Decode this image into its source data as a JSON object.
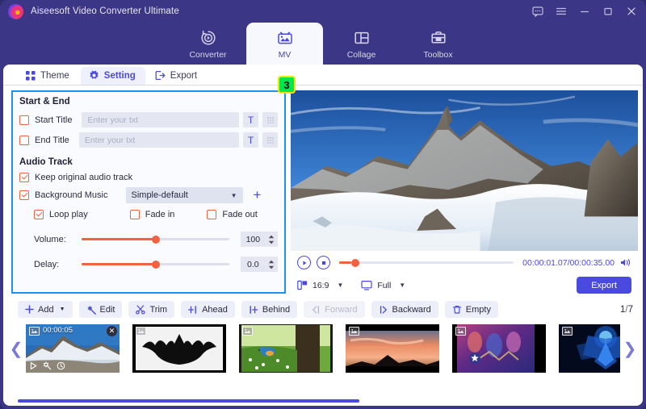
{
  "window": {
    "title": "Aiseesoft Video Converter Ultimate",
    "controls": [
      {
        "name": "feedback-icon",
        "label": "Feedback"
      },
      {
        "name": "menu-icon",
        "label": "Menu"
      },
      {
        "name": "minimize-icon",
        "label": "Minimize"
      },
      {
        "name": "maximize-icon",
        "label": "Maximize"
      },
      {
        "name": "close-icon",
        "label": "Close"
      }
    ]
  },
  "mainnav": {
    "items": [
      {
        "label": "Converter",
        "icon": "converter-icon",
        "active": false
      },
      {
        "label": "MV",
        "icon": "mv-icon",
        "active": true
      },
      {
        "label": "Collage",
        "icon": "collage-icon",
        "active": false
      },
      {
        "label": "Toolbox",
        "icon": "toolbox-icon",
        "active": false
      }
    ]
  },
  "lefttabs": {
    "items": [
      {
        "label": "Theme",
        "icon": "grid-icon",
        "active": false
      },
      {
        "label": "Setting",
        "icon": "gear-icon",
        "active": true
      },
      {
        "label": "Export",
        "icon": "export-icon",
        "active": false
      }
    ]
  },
  "callout": {
    "number": "3"
  },
  "settings": {
    "start_end": {
      "title": "Start & End",
      "start_title": {
        "label": "Start Title",
        "checked": false,
        "placeholder": "Enter your txt",
        "value": ""
      },
      "end_title": {
        "label": "End Title",
        "checked": false,
        "placeholder": "Enter your txt",
        "value": ""
      },
      "text_button": "T",
      "style_button": "style"
    },
    "audio_track": {
      "title": "Audio Track",
      "keep_original": {
        "label": "Keep original audio track",
        "checked": true
      },
      "background_music": {
        "label": "Background Music",
        "checked": true
      },
      "music_select": {
        "value": "Simple-default"
      },
      "add_button": "+",
      "loop_play": {
        "label": "Loop play",
        "checked": true
      },
      "fade_in": {
        "label": "Fade in",
        "checked": false
      },
      "fade_out": {
        "label": "Fade out",
        "checked": false
      },
      "volume": {
        "label": "Volume:",
        "value": "100",
        "percent": 50
      },
      "delay": {
        "label": "Delay:",
        "value": "0.0",
        "percent": 50
      }
    }
  },
  "player": {
    "play_label": "Play",
    "stop_label": "Stop",
    "timecode": "00:00:01.07/00:00:35.00",
    "volume_icon": "speaker-icon",
    "aspect_ratio": {
      "value": "16:9",
      "icon": "aspect-icon"
    },
    "zoom_mode": {
      "value": "Full",
      "icon": "screen-icon"
    },
    "export_label": "Export",
    "seek_percent": 7
  },
  "toolbar": {
    "buttons": [
      {
        "label": "Add",
        "icon": "plus-icon",
        "has_caret": true,
        "disabled": false
      },
      {
        "label": "Edit",
        "icon": "magic-wand-icon",
        "has_caret": false,
        "disabled": false
      },
      {
        "label": "Trim",
        "icon": "scissors-icon",
        "has_caret": false,
        "disabled": false
      },
      {
        "label": "Ahead",
        "icon": "insert-ahead-icon",
        "has_caret": false,
        "disabled": false
      },
      {
        "label": "Behind",
        "icon": "insert-behind-icon",
        "has_caret": false,
        "disabled": false
      },
      {
        "label": "Forward",
        "icon": "move-forward-icon",
        "has_caret": false,
        "disabled": true
      },
      {
        "label": "Backward",
        "icon": "move-backward-icon",
        "has_caret": false,
        "disabled": false
      },
      {
        "label": "Empty",
        "icon": "trash-icon",
        "has_caret": false,
        "disabled": false
      }
    ],
    "page_current": "1",
    "page_separator": "/",
    "page_total": "7"
  },
  "thumbnails": {
    "prev_label": "Previous",
    "next_label": "Next",
    "items": [
      {
        "name": "thumb-mountain",
        "duration": "00:00:05",
        "selected": true,
        "art": "mountain"
      },
      {
        "name": "thumb-batman",
        "duration": "",
        "selected": false,
        "art": "batman"
      },
      {
        "name": "thumb-bird",
        "duration": "",
        "selected": false,
        "art": "bird"
      },
      {
        "name": "thumb-sunset",
        "duration": "",
        "selected": false,
        "art": "sunset"
      },
      {
        "name": "thumb-avengers",
        "duration": "",
        "selected": false,
        "art": "avengers"
      },
      {
        "name": "thumb-blueflower",
        "duration": "",
        "selected": false,
        "art": "blueflower"
      },
      {
        "name": "thumb-snow",
        "duration": "",
        "selected": false,
        "art": "snow"
      }
    ],
    "scroll_percent": 56
  },
  "colors": {
    "brand_purple": "#3b3786",
    "accent_blue": "#4b4ae0",
    "accent_orange": "#f4613e",
    "highlight_border": "#1f92f0",
    "badge_green": "#00e64d",
    "badge_yellow": "#f5e400"
  }
}
